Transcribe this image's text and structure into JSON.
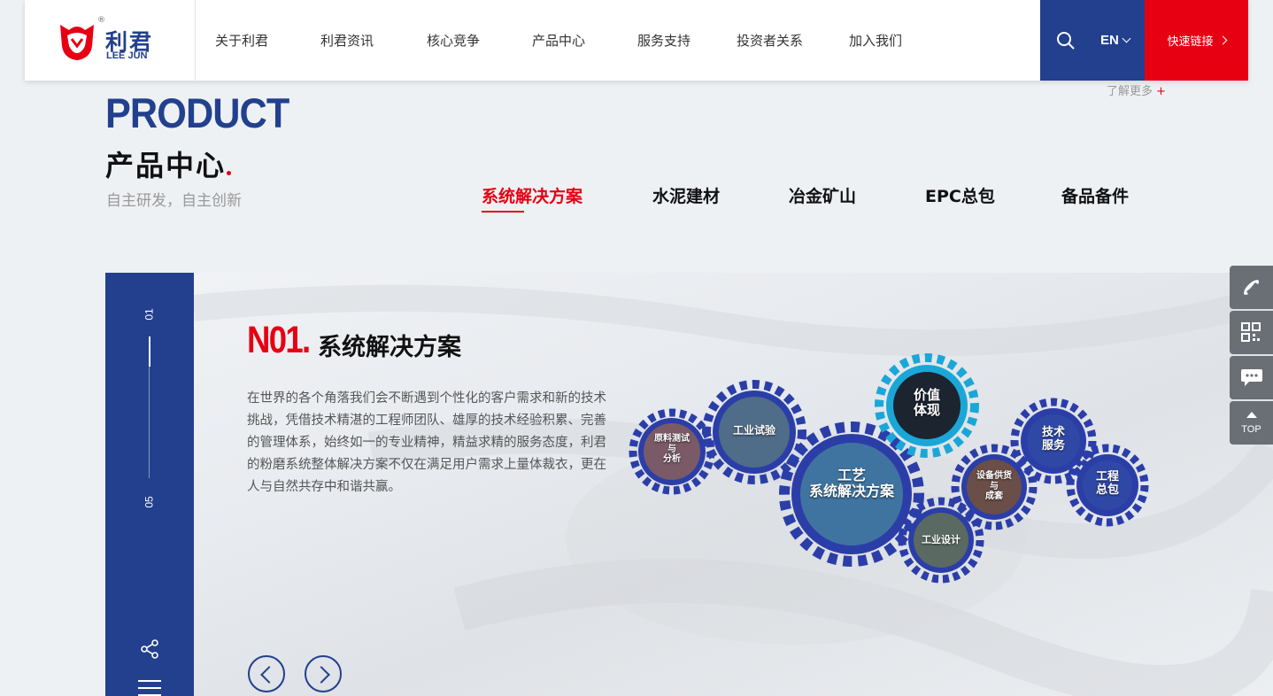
{
  "header": {
    "logo_cn": "利君",
    "logo_en": "LEE JUN",
    "logo_reg": "®",
    "nav": [
      "关于利君",
      "利君资讯",
      "核心竞争",
      "产品中心",
      "服务支持",
      "投资者关系",
      "加入我们"
    ],
    "lang": "EN",
    "quick_links": "快速链接"
  },
  "section": {
    "more": "了解更多",
    "more_plus": "+",
    "title_en": "PRODUCT",
    "title_cn": "产品中心",
    "subtitle": "自主研发，自主创新",
    "tabs": [
      "系统解决方案",
      "水泥建材",
      "冶金矿山",
      "EPC总包",
      "备品备件"
    ],
    "active_tab": 0
  },
  "slide": {
    "index_current": "01",
    "index_total": "05",
    "no": "N01.",
    "title": "系统解决方案",
    "description": "在世界的各个角落我们会不断遇到个性化的客户需求和新的技术挑战，凭借技术精湛的工程师团队、雄厚的技术经验积累、完善的管理体系，始终如一的专业精神，精益求精的服务态度，利君的粉磨系统整体解决方案不仅在满足用户需求上量体裁衣，更在人与自然共存中和谐共赢。",
    "gears": {
      "raw": "原料测试\n与\n分析",
      "industrial_test": "工业试验",
      "main": "工艺\n系统解决方案",
      "value": "价值\n体现",
      "equipment": "设备供货\n与\n成套",
      "design": "工业设计",
      "tech_service": "技术\n服务",
      "engineering": "工程\n总包"
    }
  },
  "tools": {
    "top": "TOP"
  },
  "colors": {
    "brand_blue": "#22408e",
    "brand_red": "#e60012",
    "gear_cyan": "#1aa7d8"
  }
}
